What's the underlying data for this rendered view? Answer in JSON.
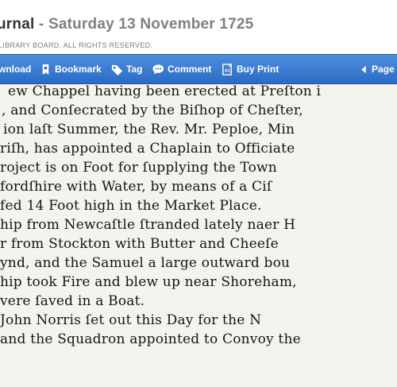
{
  "header": {
    "publication": "urnal",
    "separator": " - ",
    "date": "Saturday 13 November 1725",
    "copyright": "LIBRARY BOARD. ALL RIGHTS RESERVED."
  },
  "toolbar": {
    "download": "wnload",
    "bookmark": "Bookmark",
    "tag": "Tag",
    "comment": "Comment",
    "buy_print": "Buy Print",
    "page": "Page"
  },
  "article": {
    "lines": [
      "ew Chappel having been erected at Preſton i",
      ", and Conſecrated by the Biſhop of Cheſter,",
      "ion laſt Summer, the Rev. Mr. Peploe, Min",
      "riſh, has appointed a Chaplain to Officiate",
      "roject is on Foot for ſupplying the Town",
      "fordſhire with Water, by means of a Ciſ",
      "fed 14 Foot high in the Market Place.",
      "hip from Newcaſtle ſtranded lately naer H",
      "r from Stockton with Butter and Cheeſe",
      "ynd, and the Samuel a large outward bou",
      "hip took Fire and blew up near Shoreham,",
      "vere ſaved in a Boat.",
      "John Norris ſet out this Day for the N",
      "and the Squadron appointed to Convoy the"
    ]
  }
}
